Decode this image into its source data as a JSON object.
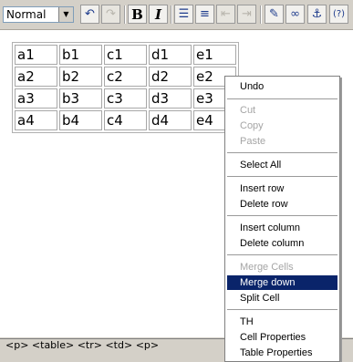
{
  "toolbar": {
    "format_select": "Normal",
    "buttons": [
      "undo-icon",
      "redo-icon",
      "bold-icon",
      "italic-icon",
      "ordered-list-icon",
      "unordered-list-icon",
      "outdent-icon",
      "indent-icon",
      "attachment-icon",
      "link-icon",
      "anchor-icon",
      "help-icon"
    ]
  },
  "table": {
    "rows": [
      [
        "a1",
        "b1",
        "c1",
        "d1",
        "e1"
      ],
      [
        "a2",
        "b2",
        "c2",
        "d2",
        "e2"
      ],
      [
        "a3",
        "b3",
        "c3",
        "d3",
        "e3"
      ],
      [
        "a4",
        "b4",
        "c4",
        "d4",
        "e4"
      ]
    ]
  },
  "status_bar": {
    "path": "<p> <table> <tr> <td> <p>"
  },
  "context_menu": {
    "undo": "Undo",
    "cut": "Cut",
    "copy": "Copy",
    "paste": "Paste",
    "select_all": "Select All",
    "insert_row": "Insert row",
    "delete_row": "Delete row",
    "insert_column": "Insert column",
    "delete_column": "Delete column",
    "merge_cells": "Merge Cells",
    "merge_down": "Merge down",
    "split_cell": "Split Cell",
    "th": "TH",
    "cell_properties": "Cell Properties",
    "table_properties": "Table Properties"
  },
  "colors": {
    "selection": "#0a246a",
    "chrome": "#d4d0c8"
  }
}
